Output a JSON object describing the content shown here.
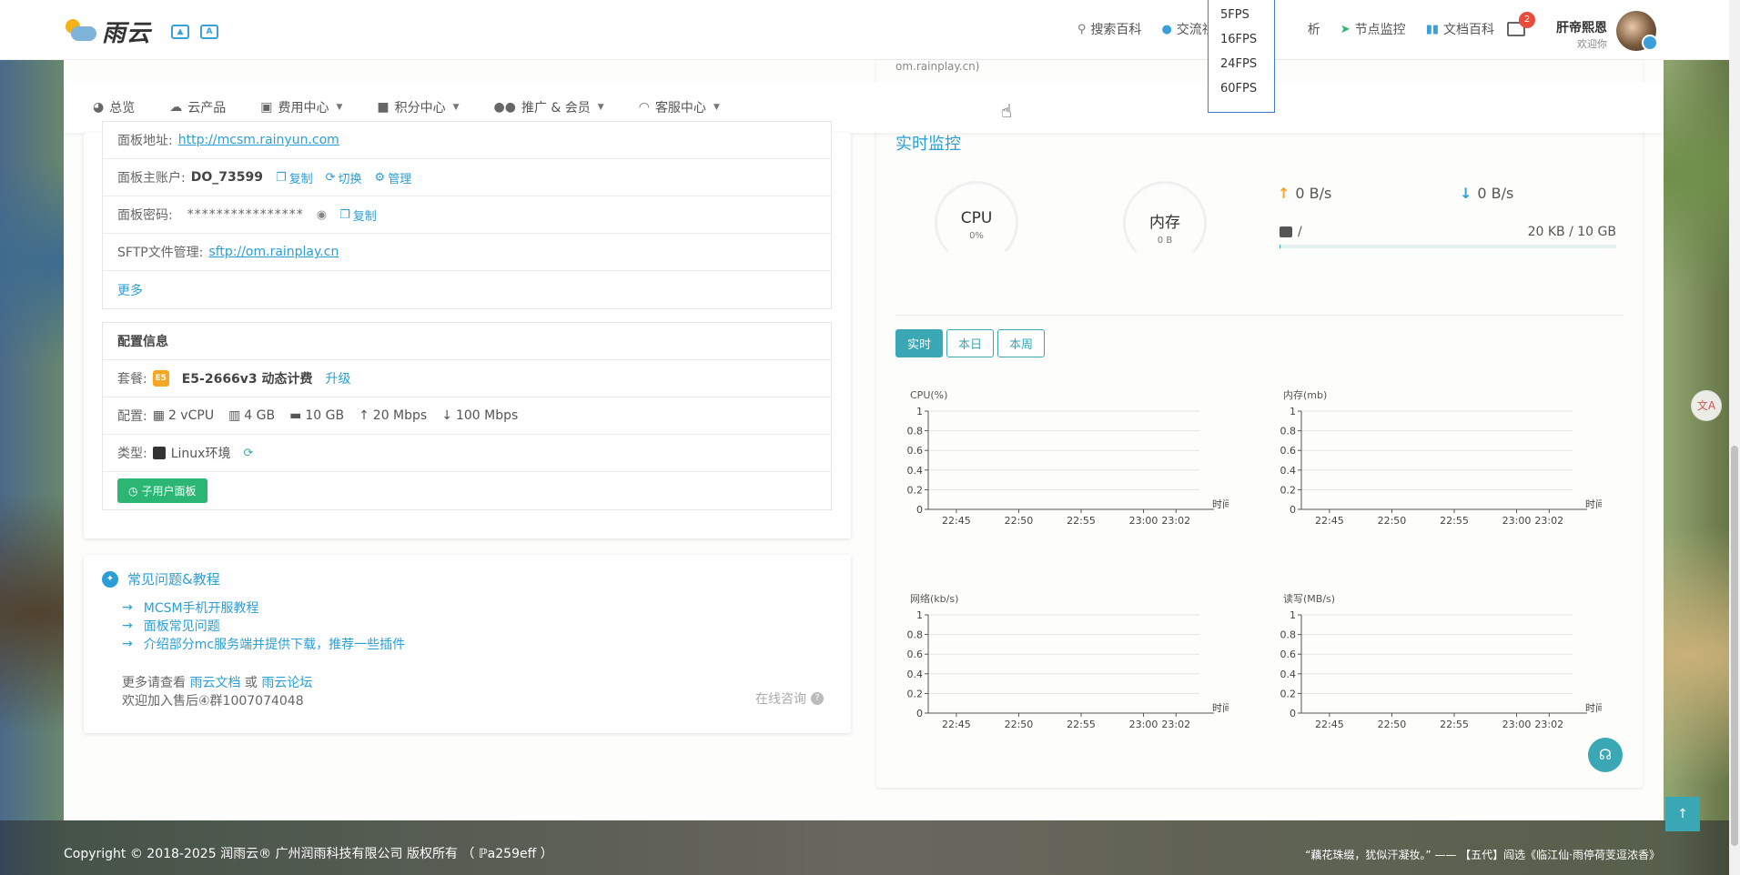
{
  "topbar": {
    "logo_text": "雨云",
    "nav": [
      {
        "icon": "search-icon",
        "label": "搜索百科"
      },
      {
        "icon": "chat-icon",
        "label": "交流社区"
      },
      {
        "icon": "",
        "label": "析"
      },
      {
        "icon": "location-arrow-icon",
        "label": "节点监控"
      },
      {
        "icon": "book-icon",
        "label": "文档百科"
      }
    ],
    "mail_count": "2",
    "user_name": "肝帝熙恩",
    "user_sub": "欢迎你"
  },
  "fps_menu": [
    "5FPS",
    "16FPS",
    "24FPS",
    "60FPS"
  ],
  "subnav": [
    {
      "icon": "dashboard-icon",
      "label": "总览",
      "caret": false
    },
    {
      "icon": "cloud-products-icon",
      "label": "云产品",
      "caret": false
    },
    {
      "icon": "money-icon",
      "label": "费用中心",
      "caret": true
    },
    {
      "icon": "gift-icon",
      "label": "积分中心",
      "caret": true
    },
    {
      "icon": "users-icon",
      "label": "推广 & 会员",
      "caret": true
    },
    {
      "icon": "headset-icon",
      "label": "客服中心",
      "caret": true
    }
  ],
  "panel": {
    "address_label": "面板地址:",
    "address_value": "http://mcsm.rainyun.com",
    "account_label": "面板主账户:",
    "account_value": "DO_73599",
    "copy_label": "复制",
    "switch_label": "切换",
    "manage_label": "管理",
    "password_label": "面板密码:",
    "password_value": "****************",
    "sftp_label": "SFTP文件管理:",
    "sftp_value": "sftp://om.rainplay.cn",
    "more_label": "更多"
  },
  "config": {
    "title": "配置信息",
    "plan_label": "套餐:",
    "plan_badge": "E5",
    "plan_value": "E5-2666v3 动态计费",
    "upgrade_label": "升级",
    "spec_label": "配置:",
    "cpu": "2 vCPU",
    "ram": "4 GB",
    "disk": "10 GB",
    "up_bw": "20 Mbps",
    "down_bw": "100 Mbps",
    "type_label": "类型:",
    "type_value": "Linux环境",
    "subuser_button": "子用户面板"
  },
  "faq": {
    "title": "常见问题&教程",
    "items": [
      "MCSM手机开服教程",
      "面板常见问题",
      "介绍部分mc服务端并提供下载，推荐一些插件"
    ],
    "more_prefix": "更多请查看",
    "docs_link": "雨云文档",
    "or": "或",
    "forum_link": "雨云论坛",
    "group": "欢迎加入售后④群1007074048",
    "online": "在线咨询"
  },
  "monitor": {
    "domain_fragment": "om.rainplay.cn)",
    "title": "实时监控",
    "cpu_name": "CPU",
    "cpu_value": "0%",
    "mem_name": "内存",
    "mem_value": "0 B",
    "upload": "0 B/s",
    "download": "0 B/s",
    "disk_path": "/",
    "disk_usage": "20 KB / 10 GB",
    "disk_fraction": 0.002,
    "tabs": [
      "实时",
      "本日",
      "本周"
    ]
  },
  "chart_data": [
    {
      "type": "line",
      "ylabel": "CPU(%)",
      "xlabel": "时间",
      "x": [
        "22:45",
        "22:50",
        "22:55",
        "23:00",
        "23:02"
      ],
      "yticks": [
        "0",
        "0.2",
        "0.4",
        "0.6",
        "0.8",
        "1"
      ],
      "ylim": [
        0,
        1
      ],
      "series": []
    },
    {
      "type": "line",
      "ylabel": "内存(mb)",
      "xlabel": "时间",
      "x": [
        "22:45",
        "22:50",
        "22:55",
        "23:00",
        "23:02"
      ],
      "yticks": [
        "0",
        "0.2",
        "0.4",
        "0.6",
        "0.8",
        "1"
      ],
      "ylim": [
        0,
        1
      ],
      "series": []
    },
    {
      "type": "line",
      "ylabel": "网络(kb/s)",
      "xlabel": "时间",
      "x": [
        "22:45",
        "22:50",
        "22:55",
        "23:00",
        "23:02"
      ],
      "yticks": [
        "0",
        "0.2",
        "0.4",
        "0.6",
        "0.8",
        "1"
      ],
      "ylim": [
        0,
        1
      ],
      "series": []
    },
    {
      "type": "line",
      "ylabel": "读写(MB/s)",
      "xlabel": "时间",
      "x": [
        "22:45",
        "22:50",
        "22:55",
        "23:00",
        "23:02"
      ],
      "yticks": [
        "0",
        "0.2",
        "0.4",
        "0.6",
        "0.8",
        "1"
      ],
      "ylim": [
        0,
        1
      ],
      "series": []
    }
  ],
  "footer": {
    "copyright": "Copyright © 2018-2025 润雨云® 广州润雨科技有限公司 版权所有 （ ℙa259eff ）",
    "quote": "“藕花珠缀，犹似汗凝妆。” —— 【五代】阎选《临江仙·雨停荷芰逗浓香》"
  },
  "colors": {
    "accent": "#2a9fd6",
    "teal": "#3aa7b4",
    "green": "#2bb673",
    "orange": "#f5a623"
  }
}
